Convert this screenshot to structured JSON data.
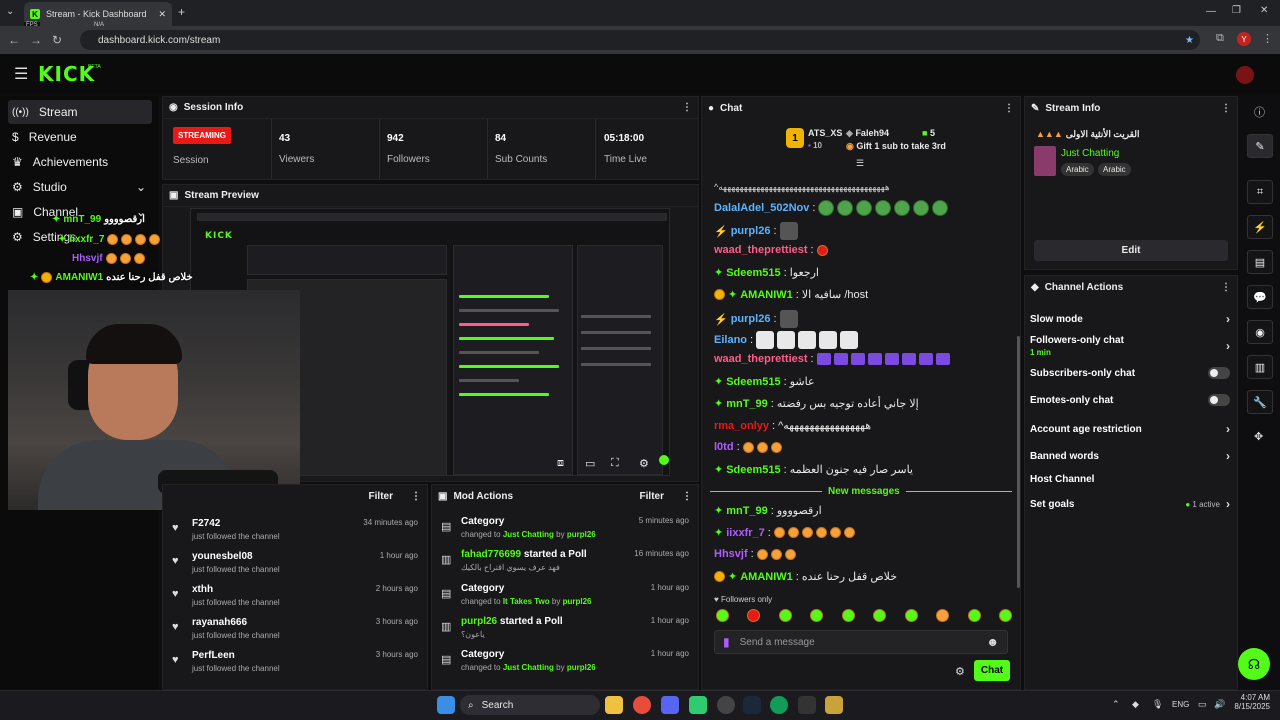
{
  "browser": {
    "tab_title": "Stream - Kick Dashboard",
    "fps_label": "FPS",
    "fps_value": "N/A",
    "url": "dashboard.kick.com/stream",
    "profile_initial": "Y"
  },
  "brand": {
    "logo": "KICK",
    "beta": "BETA",
    "accent": "#53fc18"
  },
  "sidebar": {
    "items": [
      {
        "label": "Stream",
        "icon": "broadcast-icon"
      },
      {
        "label": "Revenue",
        "icon": "dollar-icon"
      },
      {
        "label": "Achievements",
        "icon": "trophy-icon"
      },
      {
        "label": "Studio",
        "icon": "studio-icon"
      },
      {
        "label": "Channel",
        "icon": "channel-icon"
      },
      {
        "label": "Settings",
        "icon": "gear-icon"
      }
    ]
  },
  "session": {
    "title": "Session Info",
    "status": "STREAMING",
    "session_label": "Session",
    "viewers": "43",
    "viewers_label": "Viewers",
    "followers": "942",
    "followers_label": "Followers",
    "subs": "84",
    "subs_label": "Sub Counts",
    "time": "05:18:00",
    "time_label": "Time Live"
  },
  "preview": {
    "title": "Stream Preview"
  },
  "overlay_chat": [
    {
      "user": "mnT_99",
      "msg": "ارقصوووو",
      "color": "#53fc18"
    },
    {
      "user": "iixxfr_7",
      "msg": "",
      "color": "#53fc18"
    },
    {
      "user": "Hhsvjf",
      "msg": "",
      "color": "#b05cff"
    },
    {
      "user": "AMANIW1",
      "msg": "خلاص قفل رحنا عنده",
      "color": "#53fc18"
    }
  ],
  "activity": {
    "filter": "Filter",
    "items": [
      {
        "name": "F2742",
        "sub": "just followed the channel",
        "time": "34 minutes ago"
      },
      {
        "name": "younesbel08",
        "sub": "just followed the channel",
        "time": "1 hour ago"
      },
      {
        "name": "xthh",
        "sub": "just followed the channel",
        "time": "2 hours ago"
      },
      {
        "name": "rayanah666",
        "sub": "just followed the channel",
        "time": "3 hours ago"
      },
      {
        "name": "PerfLeen",
        "sub": "just followed the channel",
        "time": "3 hours ago"
      }
    ]
  },
  "mod_actions": {
    "title": "Mod Actions",
    "filter": "Filter",
    "items": [
      {
        "title": "Category",
        "pre": "changed to",
        "target": "Just Chatting",
        "by": "by",
        "user": "purpl26",
        "time": "5 minutes ago"
      },
      {
        "title": "fahad776699",
        "title2": "started a Poll",
        "sub": "فهد عرف يسوي اقتراح بالكيك",
        "time": "16 minutes ago"
      },
      {
        "title": "Category",
        "pre": "changed to",
        "target": "It Takes Two",
        "by": "by",
        "user": "purpl26",
        "time": "1 hour ago"
      },
      {
        "title": "purpl26",
        "title2": "started a Poll",
        "sub": "ياعون؟",
        "time": "1 hour ago"
      },
      {
        "title": "Category",
        "pre": "changed to",
        "target": "Just Chatting",
        "by": "by",
        "user": "purpl26",
        "time": "1 hour ago"
      }
    ]
  },
  "chat": {
    "title": "Chat",
    "top_user": "ATS_XS",
    "top_count": "10",
    "gifter": "Faleh94",
    "gift_count": "5",
    "gift_text": "Gift 1 sub to take 3rd",
    "lines": [
      {
        "user": "DalalAdel_502Nov",
        "msg": "",
        "color": "#5ab3ff"
      },
      {
        "user": "purpl26",
        "msg": "",
        "color": "#5ab3ff"
      },
      {
        "user": "waad_theprettiest",
        "msg": "",
        "color": "#ff5c8a"
      },
      {
        "user": "Sdeem515",
        "msg": "ارجعوا",
        "color": "#53fc18"
      },
      {
        "user": "AMANIW1",
        "msg": "سافيه الا /host",
        "color": "#53fc18"
      },
      {
        "user": "purpl26",
        "msg": "",
        "color": "#5ab3ff"
      },
      {
        "user": "Eilano",
        "msg": "",
        "color": "#5ab3ff"
      },
      {
        "user": "waad_theprettiest",
        "msg": "",
        "color": "#ff5c8a"
      },
      {
        "user": "Sdeem515",
        "msg": "عاشو",
        "color": "#53fc18"
      },
      {
        "user": "mnT_99",
        "msg": "إلا جاني أعاده توجيه بس رفضته",
        "color": "#53fc18"
      },
      {
        "user": "rma_onlyy",
        "msg": "^ههههههههههههههههه",
        "color": "#e91916"
      },
      {
        "user": "l0td",
        "msg": "",
        "color": "#b05cff"
      },
      {
        "user": "Sdeem515",
        "msg": "ياسر صار فيه جنون العظمه",
        "color": "#53fc18"
      }
    ],
    "new_messages": "New messages",
    "lines2": [
      {
        "user": "mnT_99",
        "msg": "ارقصوووو",
        "color": "#53fc18"
      },
      {
        "user": "iixxfr_7",
        "msg": "",
        "color": "#b05cff"
      },
      {
        "user": "Hhsvjf",
        "msg": "",
        "color": "#b05cff"
      },
      {
        "user": "AMANIW1",
        "msg": "خلاص قفل رحنا عنده",
        "color": "#53fc18"
      }
    ],
    "followers_only": "Followers only",
    "placeholder": "Send a message",
    "send": "Chat"
  },
  "stream_info": {
    "title": "Stream Info",
    "stream_title": "القريت الأنثية الاولى",
    "category": "Just Chatting",
    "tags": [
      "Arabic",
      "Arabic"
    ],
    "edit": "Edit"
  },
  "channel_actions": {
    "title": "Channel Actions",
    "items": [
      {
        "label": "Slow mode",
        "type": "chevron"
      },
      {
        "label": "Followers-only chat",
        "sub": "1 min",
        "type": "chevron"
      },
      {
        "label": "Subscribers-only chat",
        "type": "toggle"
      },
      {
        "label": "Emotes-only chat",
        "type": "toggle"
      },
      {
        "label": "Account age restriction",
        "type": "chevron"
      },
      {
        "label": "Banned words",
        "type": "chevron"
      },
      {
        "label": "Host Channel",
        "type": "none"
      },
      {
        "label": "Set goals",
        "active": "1 active",
        "type": "chevron"
      }
    ]
  },
  "taskbar": {
    "search": "Search",
    "lang": "ENG",
    "time": "4:07 AM",
    "date": "8/15/2025"
  }
}
